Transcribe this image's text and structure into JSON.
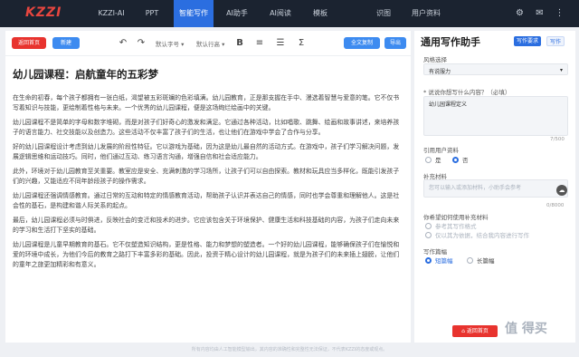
{
  "app": {
    "logo": "KZZI",
    "nav": [
      "KZZI-AI",
      "PPT",
      "智能写作",
      "AI助手",
      "AI阅读",
      "模板",
      "识图",
      "用户资料"
    ],
    "active_nav": "智能写作",
    "nav_icons": [
      "settings-icon",
      "mail-icon",
      "more-icon"
    ]
  },
  "toolbar": {
    "back_label": "返回首页",
    "new_label": "新建",
    "font_size_select": "默认字号",
    "line_height_select": "默认行高",
    "bold_glyph": "B",
    "sum_glyph": "Σ",
    "full_copy_label": "全文复制",
    "export_label": "导出"
  },
  "document": {
    "title": "幼儿园课程：启航童年的五彩梦",
    "paragraphs": [
      "在生命的初春，每个孩子都拥有一张白纸，渴望被五彩斑斓的色彩填满。幼儿园教育，正是那支握在手中、漫选着智慧与爱意的笔。它不仅书写着知识与技能，更绘制着性格与未来。一个优秀的幼儿园课程，便是这场绚烂绘画中的关键。",
      "幼儿园课程不是简单的字母和数字堆砌，而是对孩子们好奇心的激发和满足。它通过各种活动，比如唱歌、跳舞、绘画和故事讲述，来培养孩子的语言能力、社交技能以及创造力。这些活动不仅丰富了孩子们的生活，也让他们在游戏中学会了合作与分享。",
      "好的幼儿园课程设计考虑到幼儿发展的阶段性特征。它以游戏为基础，因为这是幼儿最自然的活动方式。在游戏中，孩子们学习解决问题，发展逻辑思维和运动技巧。同时，他们通过互动、练习语言沟通，增强自信和社会适应能力。",
      "此外，环境对于幼儿园教育至关重要。教室应是安全、充满刺激的学习场所，让孩子们可以自由探索。教材和玩具应当多样化，既能引发孩子们的兴趣，又能适应不同年龄段孩子的操作需求。",
      "幼儿园课程还强调情感教育。通过日常的互动和特定的情感教育活动，帮助孩子认识并表达自己的情感，同时也学会尊重和理解他人。这是社会性的基石，是构建和谐人际关系的起点。",
      "最后，幼儿园课程必须与时俱进，反映社会的变迁和技术的进步。它应该包含关于环境保护、健康生活和科技基础的内容，为孩子们走向未来的学习和生活打下坚实的基础。",
      "幼儿园课程是儿童早期教育的基石。它不仅塑造知识结构，更是性格、能力和梦想的塑造者。一个好的幼儿园课程，能够确保孩子们在愉悦和爱的环境中成长，为他们今后的教育之路打下丰富多彩的基础。因此，投资于精心设计的幼儿园课程，就是为孩子们的未来插上翅膀，让他们的童年之旅更加精彩和有意义。"
    ]
  },
  "footer": "所有内容均由人工智能模型输出，其内容的准确性和完整性无法保证，不代表KZZI的态度或观点。",
  "panel": {
    "title": "通用写作助手",
    "tag_active": "写作要求",
    "tag_inactive": "写作",
    "style_label": "风格选择",
    "style_value": "有说服力",
    "topic_label": "* 说说你想写什么内容？（必填）",
    "topic_value": "幼儿园课程定义",
    "topic_counter": "7/500",
    "cite_label": "引用用户资料",
    "cite_options": [
      "是",
      "否"
    ],
    "cite_selected": "否",
    "supp_label": "补充材料",
    "supp_placeholder": "您可以输入或添加材料，小助手会参考",
    "supp_counter": "0/8000",
    "use_supp_label": "你希望如何使用补充材料",
    "use_supp_options": [
      "参考其写作格式",
      "仅以其为依据，结合我内容进行写作"
    ],
    "length_label": "写作篇幅",
    "length_options": [
      "短篇幅",
      "长篇幅"
    ],
    "length_selected": "短篇幅",
    "submit_label": "返回首页",
    "watermark": "值 得买"
  },
  "colors": {
    "nav_bg": "#1b2330",
    "accent_blue": "#2b6ee0",
    "accent_red": "#e8332e"
  }
}
